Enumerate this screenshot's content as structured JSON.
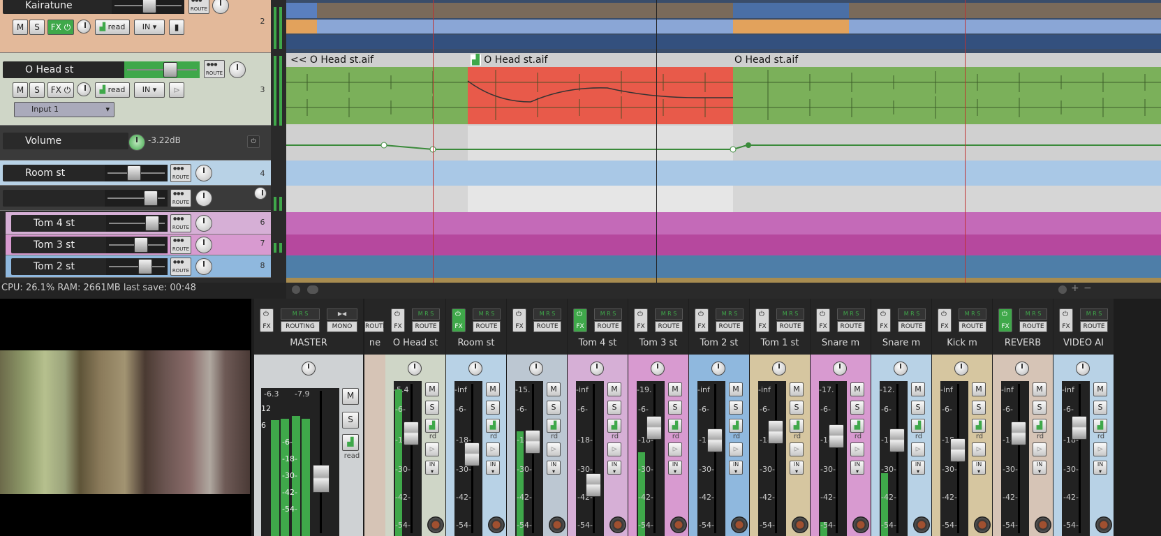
{
  "status": {
    "text": "CPU: 26.1%  RAM: 2661MB  last save: 00:48"
  },
  "tracks": [
    {
      "name": "Kairatune",
      "number": "2",
      "color": "#e3b99a"
    },
    {
      "name": "O Head st",
      "number": "3",
      "color": "#cfd6c7",
      "input": "Input 1"
    },
    {
      "name": "Volume",
      "value": "-3.22dB",
      "color": "#3a3a3a"
    },
    {
      "name": "Room st",
      "number": "4",
      "color": "#b8d2e6"
    },
    {
      "name": "",
      "number": "",
      "color": "#3a3a3a"
    },
    {
      "name": "Tom 4 st",
      "number": "6",
      "color": "#d6afd6"
    },
    {
      "name": "Tom 3 st",
      "number": "7",
      "color": "#d89ad0"
    },
    {
      "name": "Tom 2 st",
      "number": "8",
      "color": "#8fb8de"
    }
  ],
  "buttons": {
    "mute": "M",
    "solo": "S",
    "fx": "FX",
    "env": "read",
    "input": "IN",
    "route": "ROUTE",
    "routing": "ROUTING",
    "mono": "MONO",
    "in_small": "IN",
    "rd": "rd"
  },
  "items": {
    "a": "<< O Head st.aif",
    "b": "O Head st.aif",
    "c": "O Head st.aif"
  },
  "mixer": {
    "master": {
      "name": "MASTER",
      "peak_l": "-6.3",
      "peak_r": "-7.9",
      "env": "read"
    },
    "strips": [
      {
        "name": "ne",
        "color": "#d6c4b6",
        "peak": "",
        "fx_on": false
      },
      {
        "name": "O Head st",
        "color": "#cfd6c7",
        "peak": "-5.4",
        "fx_on": false
      },
      {
        "name": "Room st",
        "color": "#b8d2e6",
        "peak": "-inf",
        "fx_on": true
      },
      {
        "name": "",
        "color": "#bcc7d2",
        "peak": "-15.",
        "fx_on": false
      },
      {
        "name": "Tom 4 st",
        "color": "#d6afd6",
        "peak": "-inf",
        "fx_on": true
      },
      {
        "name": "Tom 3 st",
        "color": "#d89ad0",
        "peak": "-19.",
        "fx_on": false
      },
      {
        "name": "Tom 2 st",
        "color": "#8fb8de",
        "peak": "-inf",
        "fx_on": false
      },
      {
        "name": "Tom 1 st",
        "color": "#d6c6a0",
        "peak": "-inf",
        "fx_on": false
      },
      {
        "name": "Snare m",
        "color": "#d89ad0",
        "peak": "-17.",
        "fx_on": false
      },
      {
        "name": "Snare m",
        "color": "#b8d2e6",
        "peak": "-12.",
        "fx_on": false
      },
      {
        "name": "Kick m",
        "color": "#d6c6a0",
        "peak": "-inf",
        "fx_on": false
      },
      {
        "name": "REVERB",
        "color": "#d6c4b6",
        "peak": "-inf",
        "fx_on": true
      },
      {
        "name": "VIDEO AI",
        "color": "#b8d2e6",
        "peak": "-inf",
        "fx_on": false
      }
    ],
    "scale": [
      "-6-",
      "-18-",
      "-30-",
      "-42-",
      "-54-"
    ],
    "master_scale": [
      "12",
      "6",
      "-6-",
      "-18-",
      "-30-",
      "-42-",
      "-54-"
    ]
  }
}
